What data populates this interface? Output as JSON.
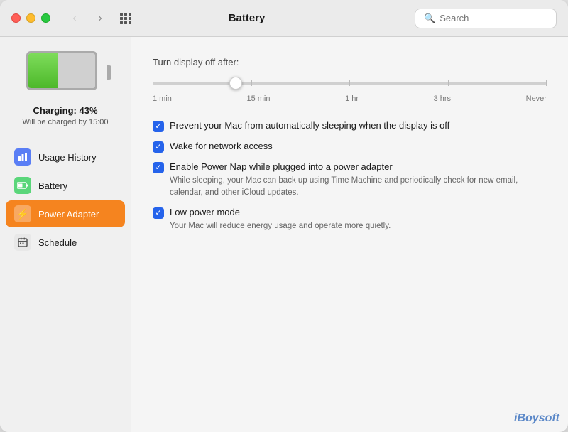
{
  "window": {
    "title": "Battery"
  },
  "titlebar": {
    "back_label": "‹",
    "forward_label": "›",
    "title": "Battery",
    "search_placeholder": "Search"
  },
  "sidebar": {
    "battery_charge": "Charging: 43%",
    "battery_charge_time": "Will be charged by 15:00",
    "nav_items": [
      {
        "id": "usage-history",
        "label": "Usage History",
        "icon": "📊",
        "icon_class": "icon-usage",
        "icon_unicode": "▦",
        "active": false
      },
      {
        "id": "battery",
        "label": "Battery",
        "icon": "🔋",
        "icon_class": "icon-battery",
        "icon_unicode": "▬",
        "active": false
      },
      {
        "id": "power-adapter",
        "label": "Power Adapter",
        "icon": "⚡",
        "icon_class": "icon-power",
        "icon_unicode": "⚡",
        "active": true
      },
      {
        "id": "schedule",
        "label": "Schedule",
        "icon": "📅",
        "icon_class": "icon-schedule",
        "icon_unicode": "▦",
        "active": false
      }
    ]
  },
  "content": {
    "slider_label": "Turn display off after:",
    "slider_marks": [
      "1 min",
      "15 min",
      "1 hr",
      "3 hrs",
      "Never"
    ],
    "options": [
      {
        "id": "prevent-sleep",
        "checked": true,
        "label": "Prevent your Mac from automatically sleeping when the display is off",
        "description": ""
      },
      {
        "id": "wake-network",
        "checked": true,
        "label": "Wake for network access",
        "description": ""
      },
      {
        "id": "power-nap",
        "checked": true,
        "label": "Enable Power Nap while plugged into a power adapter",
        "description": "While sleeping, your Mac can back up using Time Machine and periodically check for new email, calendar, and other iCloud updates."
      },
      {
        "id": "low-power",
        "checked": true,
        "label": "Low power mode",
        "description": "Your Mac will reduce energy usage and operate more quietly."
      }
    ]
  },
  "watermark": {
    "text": "iBoysoft"
  }
}
